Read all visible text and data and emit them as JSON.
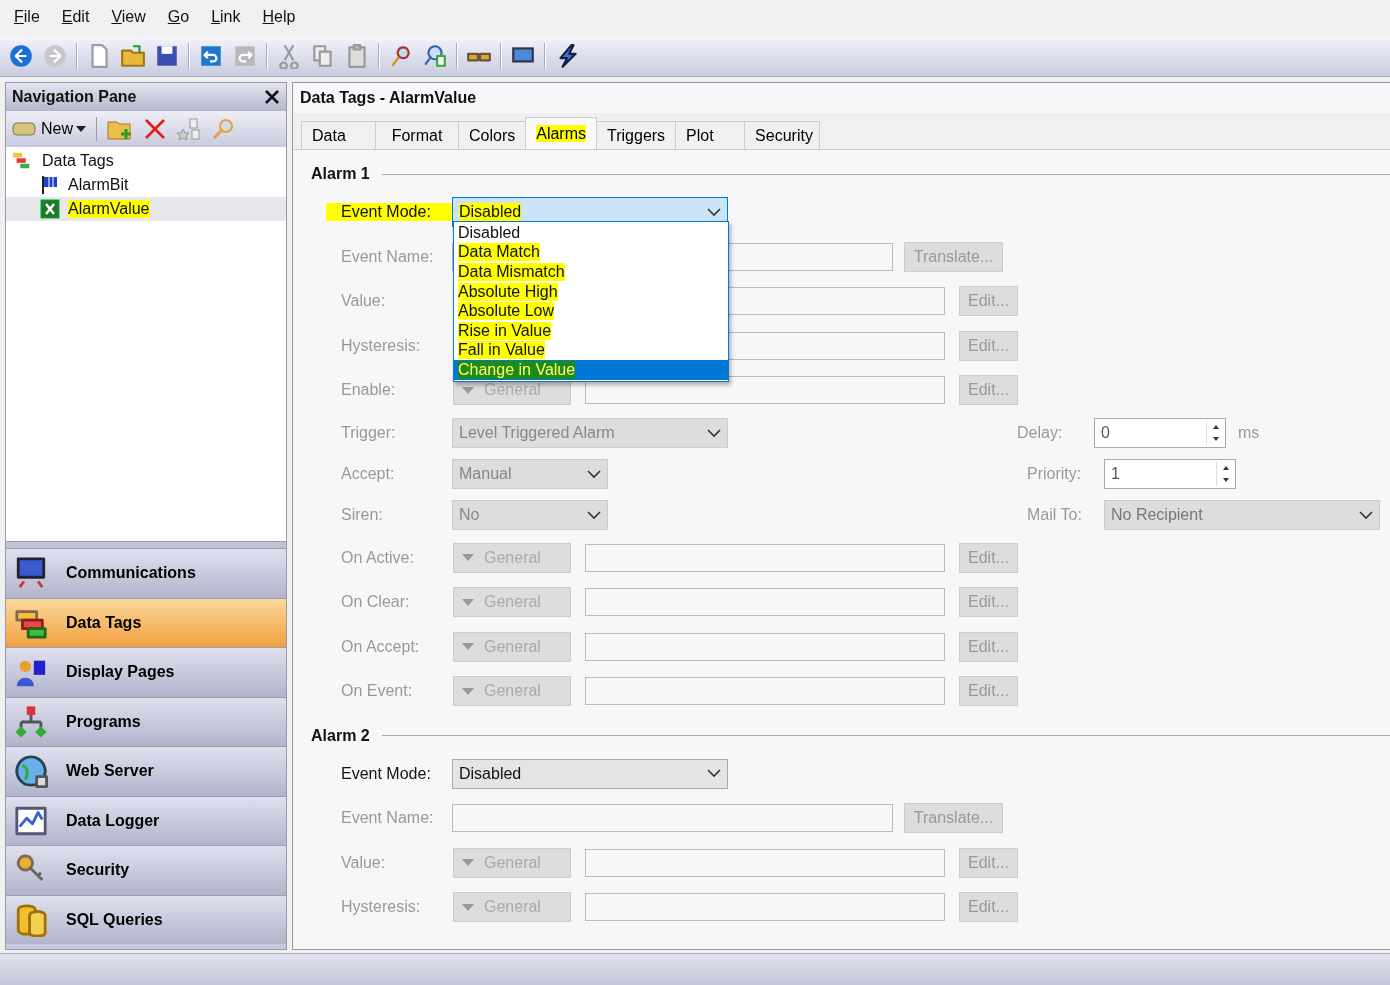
{
  "menu": [
    "File",
    "Edit",
    "View",
    "Go",
    "Link",
    "Help"
  ],
  "navigation_pane": {
    "title": "Navigation Pane",
    "new_button": "New",
    "tree": [
      {
        "label": "Data Tags",
        "selected": false,
        "highlighted": false,
        "children": [
          {
            "label": "AlarmBit",
            "selected": false,
            "highlighted": false
          },
          {
            "label": "AlarmValue",
            "selected": true,
            "highlighted": true
          }
        ]
      }
    ],
    "sections": [
      {
        "label": "Communications",
        "selected": false
      },
      {
        "label": "Data Tags",
        "selected": true
      },
      {
        "label": "Display Pages",
        "selected": false
      },
      {
        "label": "Programs",
        "selected": false
      },
      {
        "label": "Web Server",
        "selected": false
      },
      {
        "label": "Data Logger",
        "selected": false
      },
      {
        "label": "Security",
        "selected": false
      },
      {
        "label": "SQL Queries",
        "selected": false
      }
    ]
  },
  "editor": {
    "title": "Data Tags - AlarmValue",
    "tabs": [
      {
        "label": "Data",
        "selected": false,
        "highlighted": false
      },
      {
        "label": "Format",
        "selected": false,
        "highlighted": false
      },
      {
        "label": "Colors",
        "selected": false,
        "highlighted": false
      },
      {
        "label": "Alarms",
        "selected": true,
        "highlighted": true
      },
      {
        "label": "Triggers",
        "selected": false,
        "highlighted": false
      },
      {
        "label": "Plot",
        "selected": false,
        "highlighted": false
      },
      {
        "label": "Security",
        "selected": false,
        "highlighted": false
      }
    ],
    "alarms": [
      {
        "title": "Alarm 1",
        "rows": [
          {
            "kind": "combo",
            "label": "Event Mode:",
            "value": "Disabled",
            "disabled": false,
            "highlighted": true,
            "open": true
          },
          {
            "kind": "name",
            "label": "Event Name:",
            "disabled": true,
            "button": "Translate..."
          },
          {
            "kind": "expr",
            "label": "Value:",
            "disabled": true,
            "button": "Edit..."
          },
          {
            "kind": "expr",
            "label": "Hysteresis:",
            "disabled": true,
            "button": "Edit..."
          },
          {
            "kind": "expr",
            "label": "Enable:",
            "disabled": true,
            "general": "General",
            "button": "Edit..."
          },
          {
            "kind": "select",
            "label": "Trigger:",
            "value": "Level Triggered Alarm",
            "disabled": true,
            "wide": true,
            "side": {
              "kind": "spin",
              "label": "Delay:",
              "value": "0",
              "unit": "ms"
            }
          },
          {
            "kind": "select",
            "label": "Accept:",
            "value": "Manual",
            "disabled": true,
            "wide": false,
            "side": {
              "kind": "spin",
              "label": "Priority:",
              "value": "1"
            }
          },
          {
            "kind": "select",
            "label": "Siren:",
            "value": "No",
            "disabled": true,
            "wide": false,
            "side": {
              "kind": "select",
              "label": "Mail To:",
              "value": "No Recipient"
            }
          },
          {
            "kind": "expr",
            "label": "On Active:",
            "disabled": true,
            "general": "General",
            "button": "Edit..."
          },
          {
            "kind": "expr",
            "label": "On Clear:",
            "disabled": true,
            "general": "General",
            "button": "Edit..."
          },
          {
            "kind": "expr",
            "label": "On Accept:",
            "disabled": true,
            "general": "General",
            "button": "Edit..."
          },
          {
            "kind": "expr",
            "label": "On Event:",
            "disabled": true,
            "general": "General",
            "button": "Edit..."
          }
        ],
        "dropdown": [
          {
            "label": "Disabled",
            "selected": false,
            "highlighted": false
          },
          {
            "label": "Data Match",
            "selected": false,
            "highlighted": true
          },
          {
            "label": "Data Mismatch",
            "selected": false,
            "highlighted": true
          },
          {
            "label": "Absolute High",
            "selected": false,
            "highlighted": true
          },
          {
            "label": "Absolute Low",
            "selected": false,
            "highlighted": true
          },
          {
            "label": "Rise in Value",
            "selected": false,
            "highlighted": true
          },
          {
            "label": "Fall in Value",
            "selected": false,
            "highlighted": true
          },
          {
            "label": "Change in Value",
            "selected": true,
            "highlighted": true
          }
        ]
      },
      {
        "title": "Alarm 2",
        "rows": [
          {
            "kind": "combo",
            "label": "Event Mode:",
            "value": "Disabled",
            "disabled": false,
            "highlighted": false,
            "open": false
          },
          {
            "kind": "name",
            "label": "Event Name:",
            "disabled": true,
            "button": "Translate..."
          },
          {
            "kind": "expr",
            "label": "Value:",
            "disabled": true,
            "general": "General",
            "button": "Edit..."
          },
          {
            "kind": "expr",
            "label": "Hysteresis:",
            "disabled": true,
            "general": "General",
            "button": "Edit..."
          }
        ]
      }
    ]
  }
}
